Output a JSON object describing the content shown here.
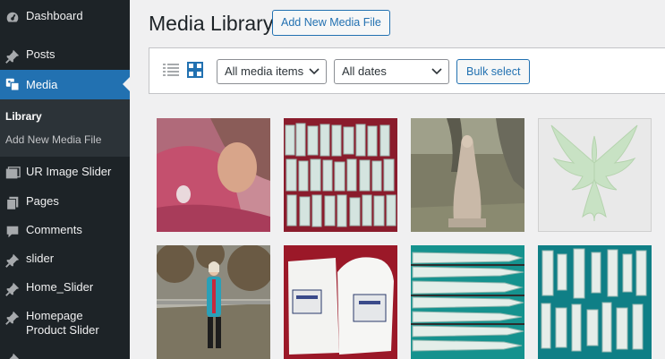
{
  "sidebar": {
    "items": [
      {
        "label": "Dashboard",
        "icon": "dashboard-icon"
      },
      {
        "label": "Posts",
        "icon": "pin-icon"
      },
      {
        "label": "Media",
        "icon": "media-icon"
      },
      {
        "label": "UR Image Slider",
        "icon": "image-slider-icon"
      },
      {
        "label": "Pages",
        "icon": "pages-icon"
      },
      {
        "label": "Comments",
        "icon": "comments-icon"
      },
      {
        "label": "slider",
        "icon": "pin-icon"
      },
      {
        "label": "Home_Slider",
        "icon": "pin-icon"
      },
      {
        "label": "Homepage Product Slider",
        "icon": "pin-icon"
      }
    ],
    "submenu": [
      {
        "label": "Library"
      },
      {
        "label": "Add New Media File"
      }
    ]
  },
  "header": {
    "title": "Media Library",
    "add_new_label": "Add New Media File"
  },
  "toolbar": {
    "filter_type": "All media items",
    "filter_date": "All dates",
    "bulk_label": "Bulk select"
  },
  "colors": {
    "sidebar_bg": "#1d2327",
    "accent": "#2271b1",
    "page_bg": "#f0f0f1"
  }
}
